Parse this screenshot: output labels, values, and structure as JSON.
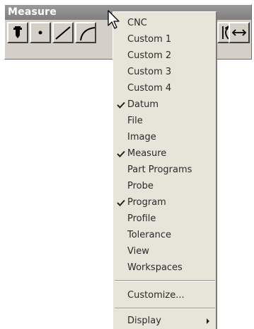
{
  "toolbar": {
    "title": "Measure",
    "buttons": [
      {
        "icon": "probe-icon"
      },
      {
        "icon": "point-icon"
      },
      {
        "icon": "line-icon"
      },
      {
        "icon": "arc-icon"
      },
      {
        "icon": "circle-distance-icon"
      },
      {
        "icon": "distance-arrow-icon"
      }
    ]
  },
  "menu": {
    "items": [
      {
        "label": "CNC",
        "checked": false
      },
      {
        "label": "Custom 1",
        "checked": false
      },
      {
        "label": "Custom 2",
        "checked": false
      },
      {
        "label": "Custom 3",
        "checked": false
      },
      {
        "label": "Custom 4",
        "checked": false
      },
      {
        "label": "Datum",
        "checked": true
      },
      {
        "label": "File",
        "checked": false
      },
      {
        "label": "Image",
        "checked": false
      },
      {
        "label": "Measure",
        "checked": true
      },
      {
        "label": "Part Programs",
        "checked": false
      },
      {
        "label": "Probe",
        "checked": false
      },
      {
        "label": "Program",
        "checked": true
      },
      {
        "label": "Profile",
        "checked": false
      },
      {
        "label": "Tolerance",
        "checked": false
      },
      {
        "label": "View",
        "checked": false
      },
      {
        "label": "Workspaces",
        "checked": false
      }
    ],
    "customize_label": "Customize...",
    "display_label": "Display"
  },
  "colors": {
    "menu_bg": "#e7e4da",
    "toolbar_bg": "#d4d0c8",
    "titlebar": "#8a8a8a",
    "text": "#2a2a2a"
  }
}
